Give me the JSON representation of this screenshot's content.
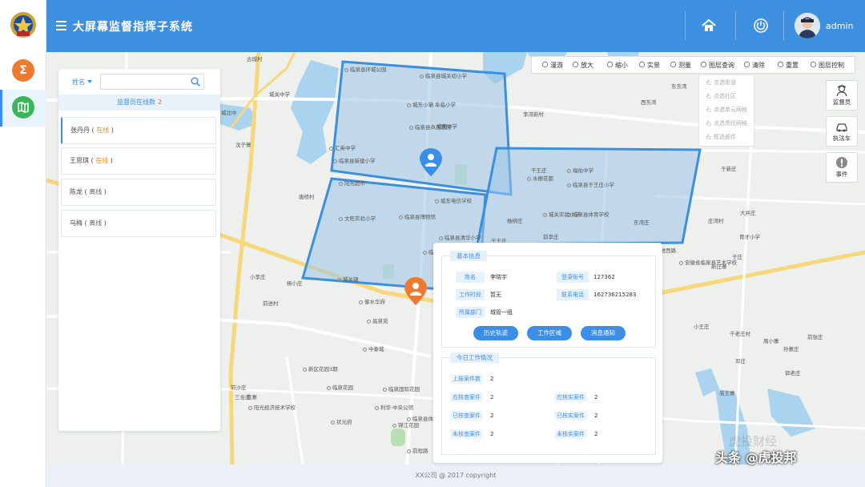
{
  "header": {
    "title": "大屏幕监督指挥子系统",
    "username": "admin"
  },
  "panel": {
    "search_field": "姓名",
    "search_value": "",
    "online_label": "监督员在线数",
    "online_count": "2",
    "inspectors": [
      {
        "name": "张丹丹",
        "status": "在线"
      },
      {
        "name": "王思琪",
        "status": "在线"
      },
      {
        "name": "陈龙",
        "status": "离线"
      },
      {
        "name": "乌梅",
        "status": "离线"
      }
    ]
  },
  "toolbar": {
    "tools": [
      "漫游",
      "放大",
      "缩小",
      "实景",
      "测量",
      "图层查询",
      "清除",
      "重置",
      "图层控制"
    ]
  },
  "layer_menu": {
    "options": [
      "点选街道",
      "点选社区",
      "点选单元网格",
      "点选责任网格",
      "框选部件"
    ]
  },
  "side_buttons": [
    "监督员",
    "执法车",
    "事件"
  ],
  "info": {
    "basic_title": "基本信息",
    "fields": {
      "name_label": "姓名",
      "name_value": "李晓宇",
      "login_label": "登录账号",
      "login_value": "127362",
      "time_label": "工作时段",
      "time_value": "暂无",
      "phone_label": "联系电话",
      "phone_value": "162736215283",
      "dept_label": "所属部门",
      "dept_value": "城管一组"
    },
    "buttons": [
      "历史轨迹",
      "工作区域",
      "消息通知"
    ],
    "work_title": "今日工作情况",
    "stats": [
      {
        "label": "上报案件数",
        "value": "2"
      },
      {
        "label": "应核查案件",
        "value": "2"
      },
      {
        "label": "应核实案件",
        "value": "2"
      },
      {
        "label": "已核查案件",
        "value": "2"
      },
      {
        "label": "已核实案件",
        "value": "2"
      },
      {
        "label": "未核查案件",
        "value": "2"
      },
      {
        "label": "未核实案件",
        "value": "2"
      }
    ]
  },
  "map_labels": {
    "poi": [
      "临泉县环城公园",
      "临泉县城关初小学",
      "城东小学",
      "阜临小学",
      "临泉县人民医院",
      "城南中学",
      "汇英中学",
      "临泉县新建小学",
      "阳光超市",
      "福佑中学",
      "水榭花都",
      "临泉县于王庄小学",
      "临泉县博物馆",
      "文旺实验小学",
      "城东电信学校",
      "临泉县体育学校",
      "城关实验小学",
      "临泉县清华小学",
      "临泉县就业服务局",
      "城关镇",
      "御水华府",
      "昌泉苑",
      "中泰城",
      "新区花园3期",
      "临泉花园",
      "临泉国际花园",
      "利华·中央公馆",
      "锦江花园",
      "状元府",
      "阳光经济技术学校",
      "临泉县体育场",
      "前程路",
      "安徽省临泉县艺术学校"
    ],
    "places": [
      "古城村",
      "吕寨",
      "城北中",
      "沈子寨",
      "李湾新村",
      "东东湾",
      "西东湾",
      "干王庄",
      "于新庄",
      "庄湾村",
      "大井庄",
      "育才小学",
      "东湾庄",
      "于庄",
      "新庄寨",
      "前李庄",
      "小王庄",
      "千老庄村",
      "周小寨",
      "郭老庄",
      "邓庄",
      "前沙庄",
      "三合庄",
      "前进村",
      "杨小庄",
      "小李庄",
      "唐桥村",
      "庞寨",
      "庙王寨",
      "孙寨庄",
      "后老庄",
      "前张庄",
      "于王庄",
      "杨柳庄",
      "城关中学",
      "新建路",
      "前进西路"
    ]
  },
  "footer": {
    "copyright": "XX公司 @ 2017 copyright"
  },
  "watermark": {
    "text": "头条 @虎投邦",
    "faint": "虎投财经"
  }
}
